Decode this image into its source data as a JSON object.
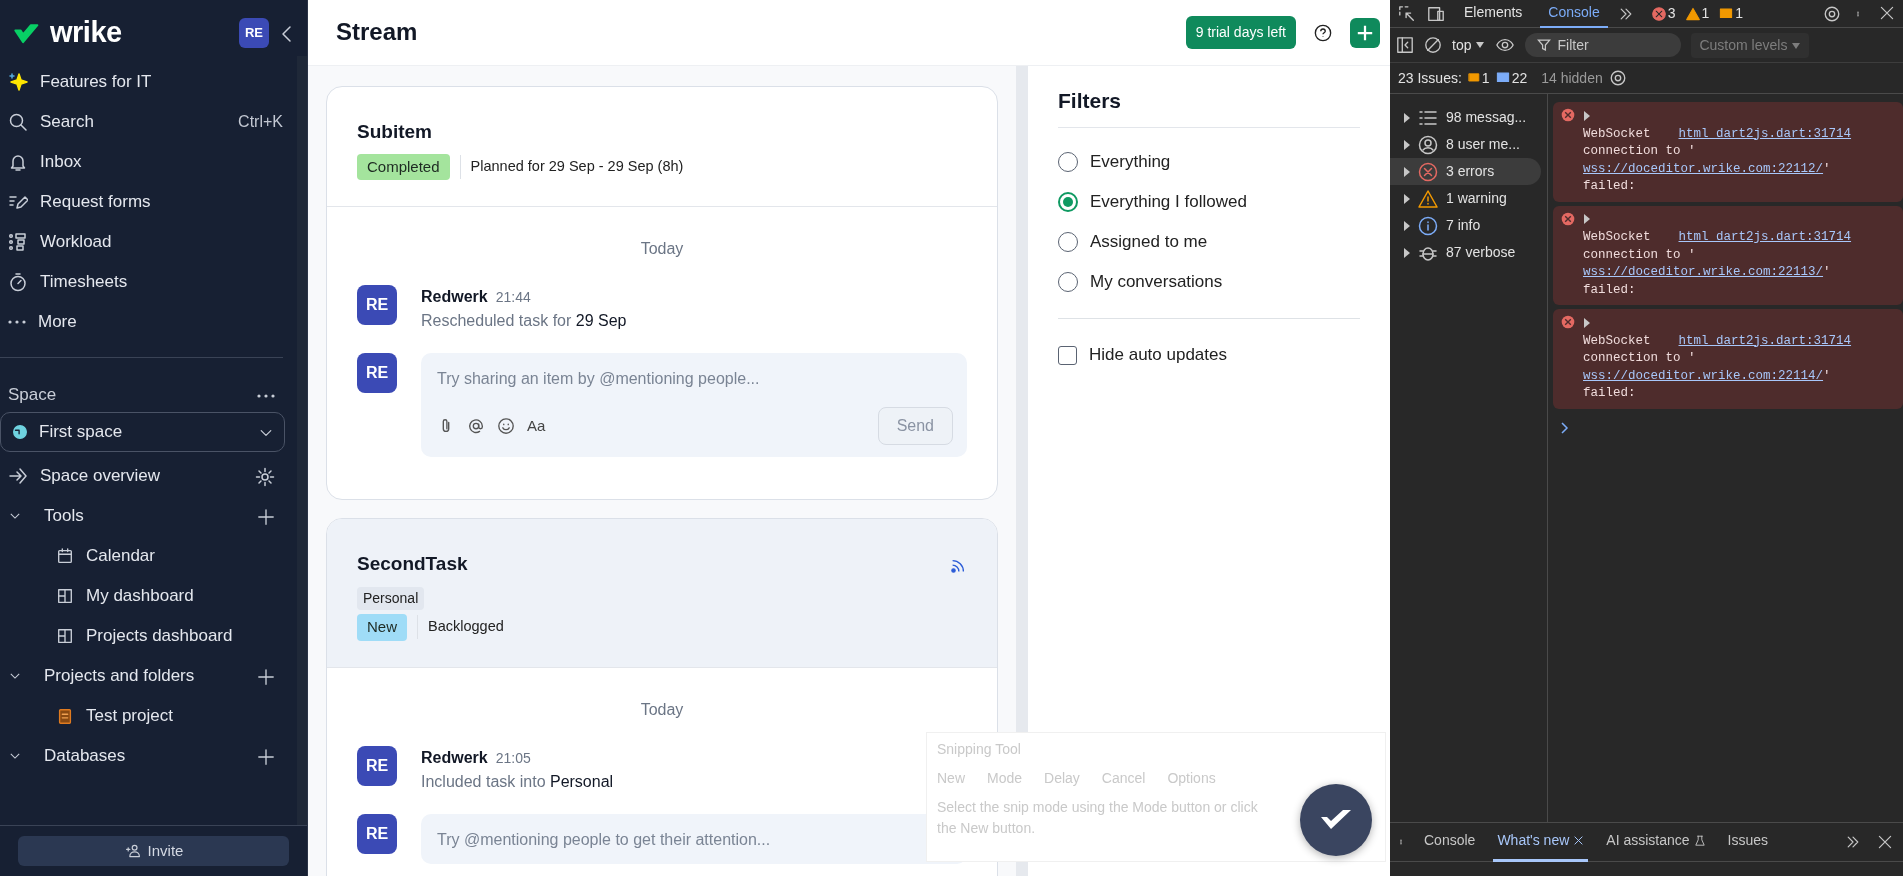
{
  "sidebar": {
    "logo": "wrike",
    "avatar": "RE",
    "nav": [
      {
        "label": "Features for IT"
      },
      {
        "label": "Search",
        "shortcut": "Ctrl+K"
      },
      {
        "label": "Inbox"
      },
      {
        "label": "Request forms"
      },
      {
        "label": "Workload"
      },
      {
        "label": "Timesheets"
      },
      {
        "label": "More"
      }
    ],
    "space": {
      "label": "Space",
      "selector": "First space"
    },
    "overview": "Space overview",
    "sections": [
      {
        "label": "Tools",
        "expanded": true,
        "children": [
          {
            "label": "Calendar"
          },
          {
            "label": "My dashboard"
          },
          {
            "label": "Projects dashboard"
          }
        ]
      },
      {
        "label": "Projects and folders",
        "expanded": true,
        "children": [
          {
            "label": "Test project"
          }
        ]
      },
      {
        "label": "Databases",
        "expanded": true
      }
    ],
    "invite": "Invite"
  },
  "header": {
    "title": "Stream",
    "trial": "9 trial days left"
  },
  "stream": [
    {
      "title": "Subitem",
      "following": false,
      "status": {
        "label": "Completed",
        "color": "#a4e49d"
      },
      "info": "Planned for 29 Sep - 29 Sep (8h)",
      "day": "Today",
      "entries": [
        {
          "author": "Redwerk",
          "avatar": "RE",
          "time": "21:44",
          "action": "Rescheduled task for",
          "object": "29 Sep"
        }
      ],
      "comment": {
        "avatar": "RE",
        "placeholder": "Try sharing an item by @mentioning people...",
        "send": "Send",
        "format": "Aa"
      }
    },
    {
      "title": "SecondTask",
      "following": true,
      "tag": "Personal",
      "status": {
        "label": "New",
        "color": "#9fdcf7"
      },
      "info": "Backlogged",
      "day": "Today",
      "entries": [
        {
          "author": "Redwerk",
          "avatar": "RE",
          "time": "21:05",
          "action": "Included task into",
          "object": "Personal"
        }
      ],
      "comment": {
        "avatar": "RE",
        "placeholder": "Try @mentioning people to get their attention..."
      }
    }
  ],
  "filters": {
    "title": "Filters",
    "options": [
      {
        "label": "Everything",
        "selected": false
      },
      {
        "label": "Everything I followed",
        "selected": true
      },
      {
        "label": "Assigned to me",
        "selected": false
      },
      {
        "label": "My conversations",
        "selected": false
      }
    ],
    "hide_auto_updates": {
      "label": "Hide auto updates",
      "checked": false
    }
  },
  "snipping_tool": {
    "title": "Snipping Tool",
    "buttons": [
      "New",
      "Mode",
      "Delay",
      "Cancel",
      "Options"
    ],
    "hint": "Select the snip mode using the Mode button or click the New button."
  },
  "devtools": {
    "tabs": [
      {
        "label": "Elements",
        "selected": false
      },
      {
        "label": "Console",
        "selected": true
      }
    ],
    "counts": {
      "errors": "3",
      "warnings": "1",
      "issues": "1"
    },
    "context": "top",
    "filter_placeholder": "Filter",
    "levels": "Custom levels",
    "issues_bar": {
      "label": "23 Issues:",
      "warnings": "1",
      "infos": "22",
      "hidden": "14 hidden"
    },
    "groups": [
      {
        "label": "98 messag...",
        "kind": "messages",
        "selected": false
      },
      {
        "label": "8 user me...",
        "kind": "user",
        "selected": false
      },
      {
        "label": "3 errors",
        "kind": "error",
        "selected": true
      },
      {
        "label": "1 warning",
        "kind": "warning",
        "selected": false
      },
      {
        "label": "7 info",
        "kind": "info",
        "selected": false
      },
      {
        "label": "87 verbose",
        "kind": "verbose",
        "selected": false
      }
    ],
    "messages": [
      {
        "head": "WebSocket",
        "source": "html_dart2js.dart:31714",
        "pre": "connection to '",
        "url": "wss://doceditor.wrike.com:22112/",
        "post": "'",
        "tail": "failed:"
      },
      {
        "head": "WebSocket",
        "source": "html_dart2js.dart:31714",
        "pre": "connection to '",
        "url": "wss://doceditor.wrike.com:22113/",
        "post": "'",
        "tail": "failed:"
      },
      {
        "head": "WebSocket",
        "source": "html_dart2js.dart:31714",
        "pre": "connection to '",
        "url": "wss://doceditor.wrike.com:22114/",
        "post": "'",
        "tail": "failed:"
      }
    ],
    "drawer_tabs": [
      {
        "label": "Console",
        "selected": false,
        "closable": false,
        "kind": "plain"
      },
      {
        "label": "What's new",
        "selected": true,
        "closable": true,
        "kind": "plain"
      },
      {
        "label": "AI assistance",
        "selected": false,
        "closable": false,
        "kind": "lab"
      },
      {
        "label": "Issues",
        "selected": false,
        "closable": false,
        "kind": "plain"
      }
    ]
  }
}
